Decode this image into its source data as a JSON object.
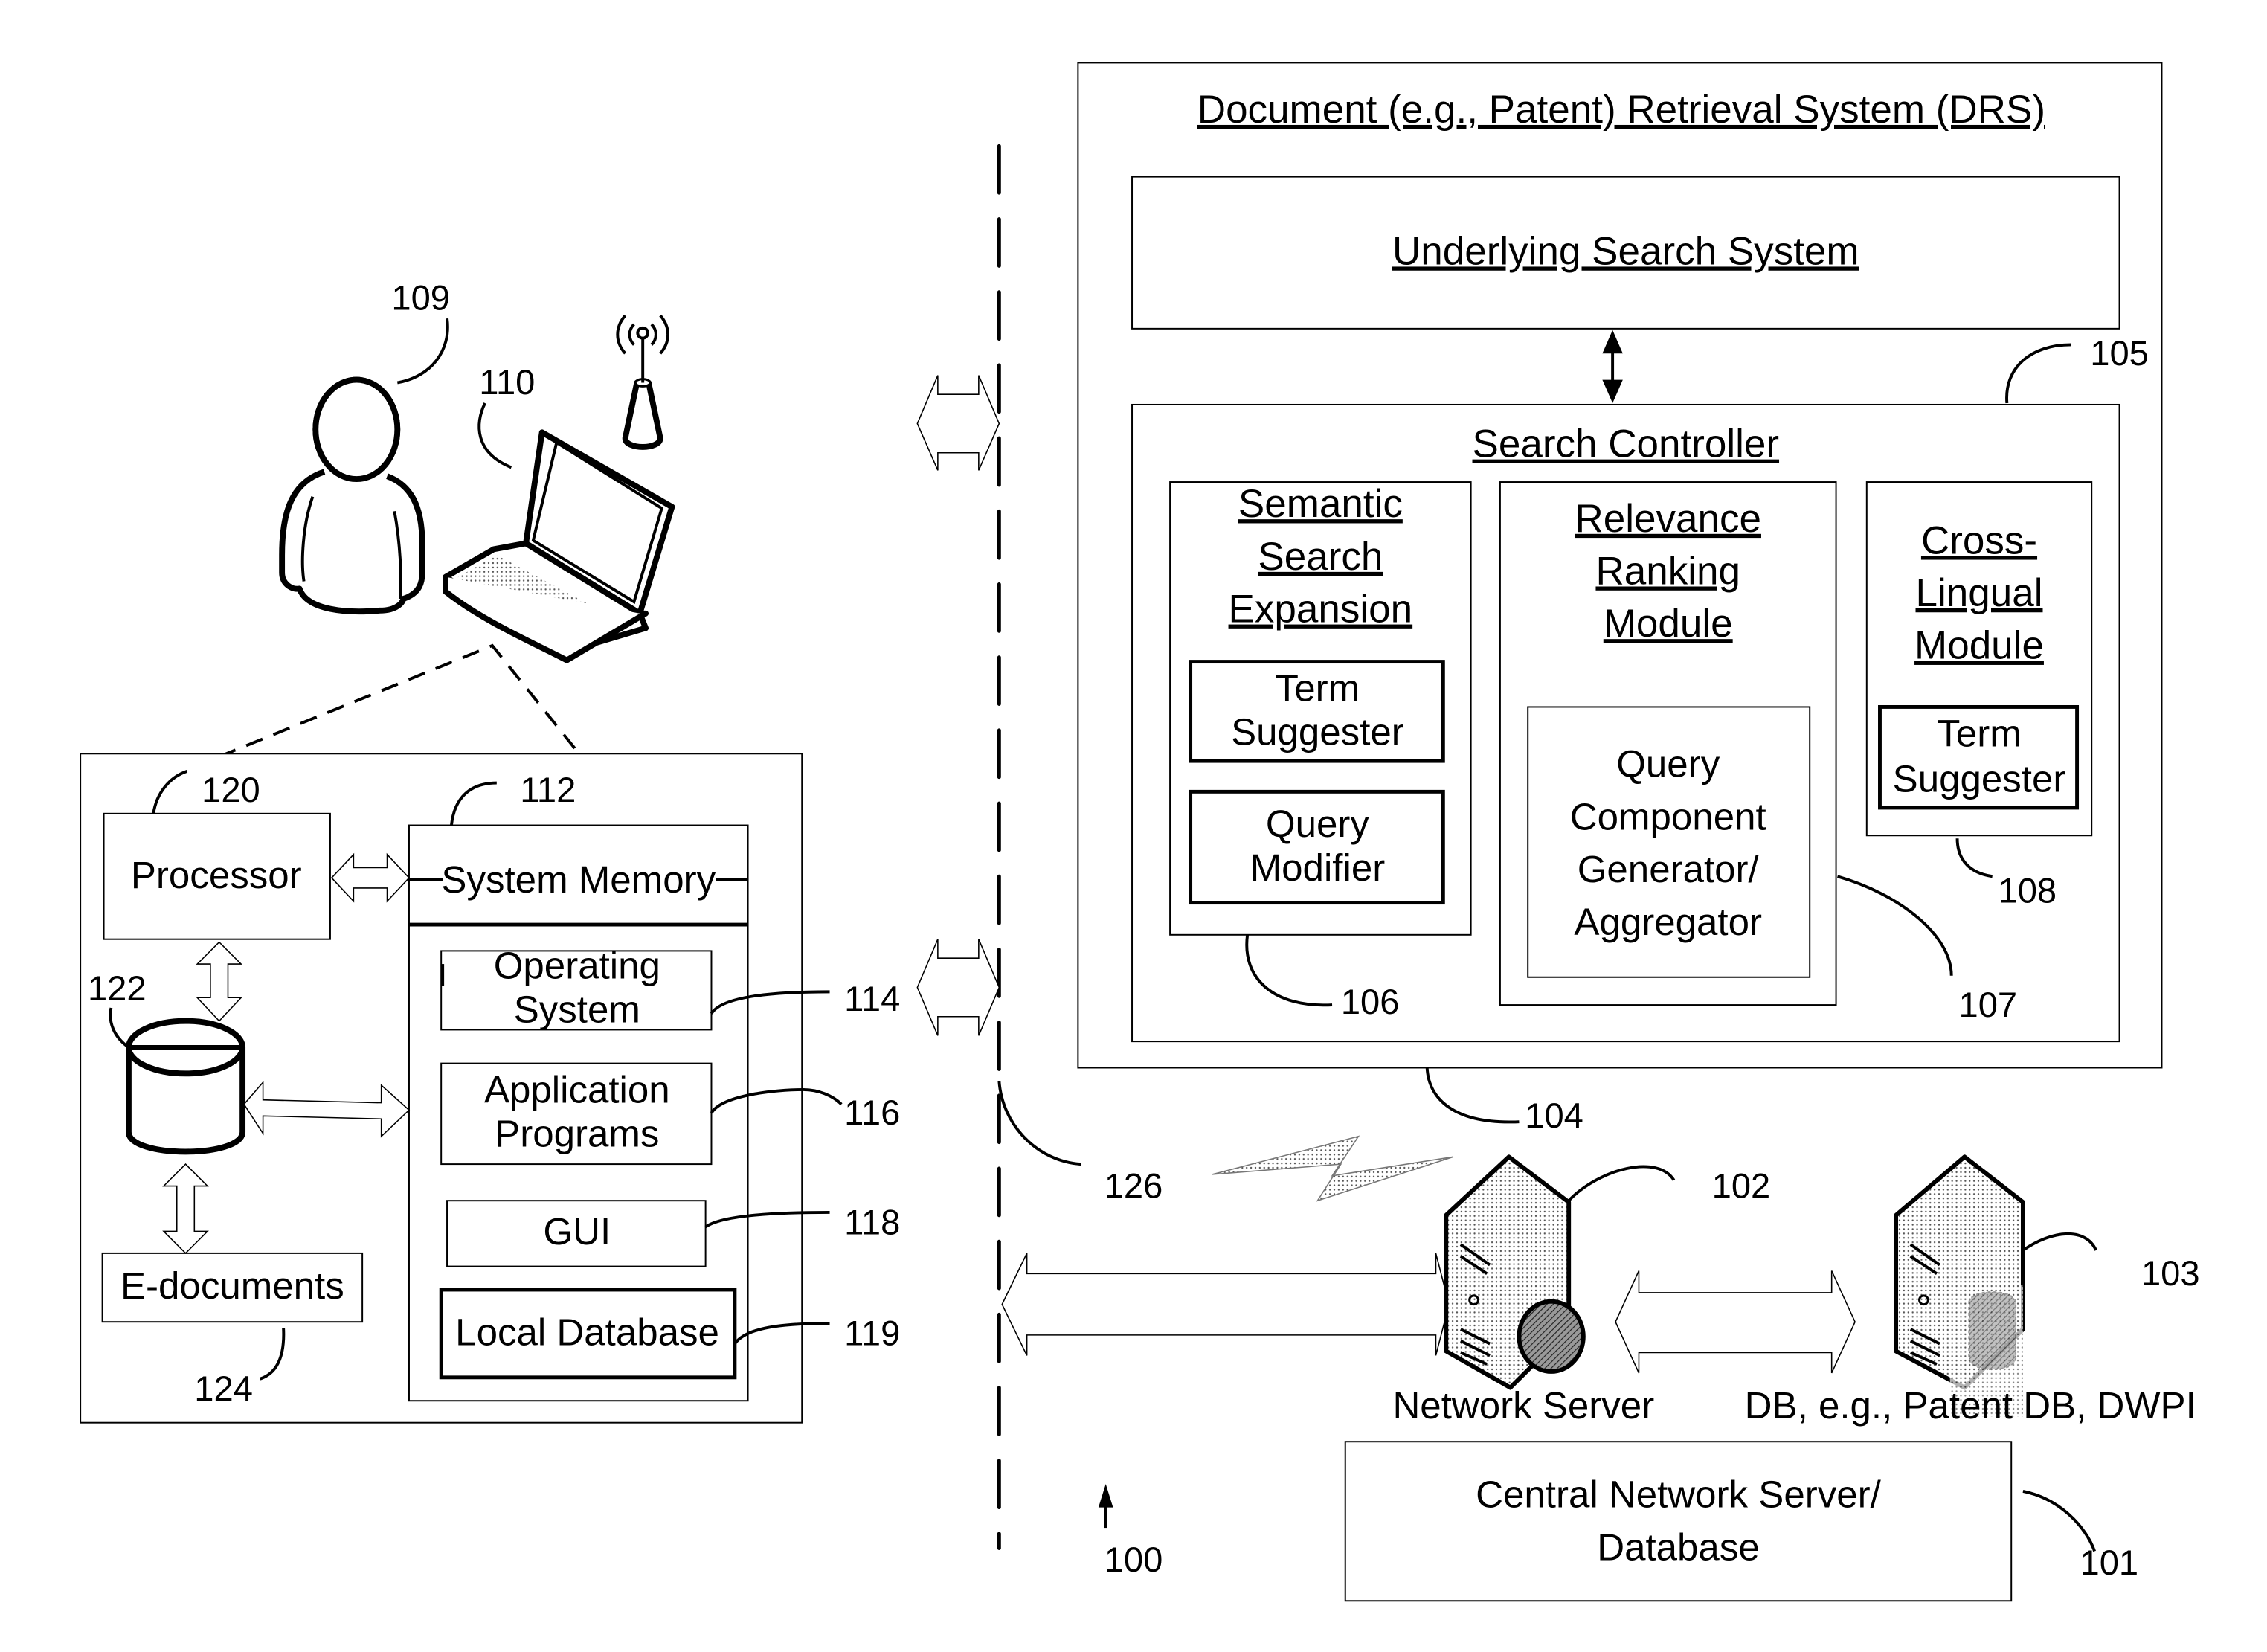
{
  "figure": {
    "ref_overall": "100"
  },
  "drs": {
    "title": "Document (e.g., Patent) Retrieval System (DRS)",
    "ref": "104",
    "underlying_search": "Underlying Search System",
    "search_controller": {
      "title": "Search Controller",
      "ref": "105",
      "semantic": {
        "title_lines": [
          "Semantic",
          "Search",
          "Expansion"
        ],
        "ref": "106",
        "term_suggester": [
          "Term",
          "Suggester"
        ],
        "query_modifier": [
          "Query",
          "Modifier"
        ]
      },
      "relevance": {
        "title_lines": [
          "Relevance",
          "Ranking",
          "Module"
        ],
        "ref": "107",
        "qcg_lines": [
          "Query",
          "Component",
          "Generator/",
          "Aggregator"
        ]
      },
      "cross_lingual": {
        "title_lines": [
          "Cross-",
          "Lingual",
          "Module"
        ],
        "ref": "108",
        "term_suggester": [
          "Term",
          "Suggester"
        ]
      }
    }
  },
  "user": {
    "person_ref": "109",
    "laptop_ref": "110"
  },
  "client": {
    "processor": {
      "label": "Processor",
      "ref": "120"
    },
    "system_memory": {
      "label": "System Memory",
      "ref": "112"
    },
    "os": {
      "lines": [
        "Operating",
        "System"
      ],
      "ref": "114"
    },
    "apps": {
      "lines": [
        "Application",
        "Programs"
      ],
      "ref": "116"
    },
    "gui": {
      "label": "GUI",
      "ref": "118"
    },
    "local_db": {
      "label": "Local Database",
      "ref": "119"
    },
    "storage": {
      "ref": "122"
    },
    "edocs": {
      "label": "E-documents",
      "ref": "124"
    }
  },
  "network": {
    "wireless_ref": "126",
    "network_server": {
      "label": "Network Server",
      "ref": "102"
    },
    "db_server": {
      "label": "DB, e.g., Patent DB, DWPI",
      "ref": "103"
    },
    "central": {
      "lines": [
        "Central Network Server/",
        "Database"
      ],
      "ref": "101"
    }
  }
}
